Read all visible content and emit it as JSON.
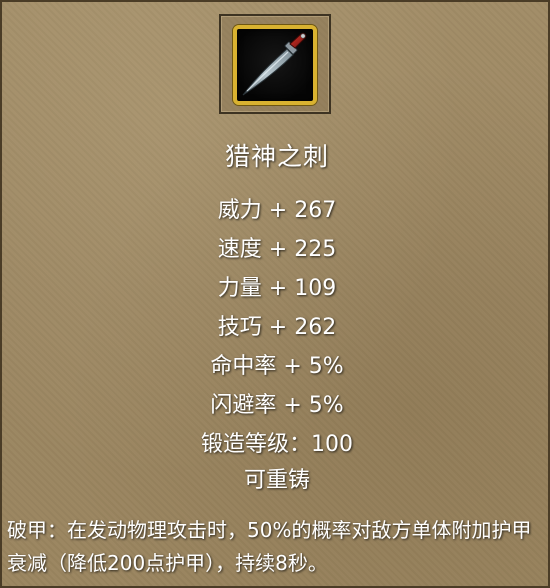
{
  "item": {
    "icon": "hunting-knife-icon",
    "name": "猎神之刺",
    "stats": [
      "威力 + 267",
      "速度 + 225",
      "力量 + 109",
      "技巧 + 262",
      "命中率 + 5%",
      "闪避率 + 5%",
      "锻造等级：100"
    ],
    "reforge_text": "可重铸",
    "effect_text": "破甲：在发动物理攻击时，50%的概率对敌方单体附加护甲衰减（降低200点护甲），持续8秒。"
  },
  "colors": {
    "background": "#9d8862",
    "text": "#ffffff",
    "icon_border": "#d9b230"
  }
}
